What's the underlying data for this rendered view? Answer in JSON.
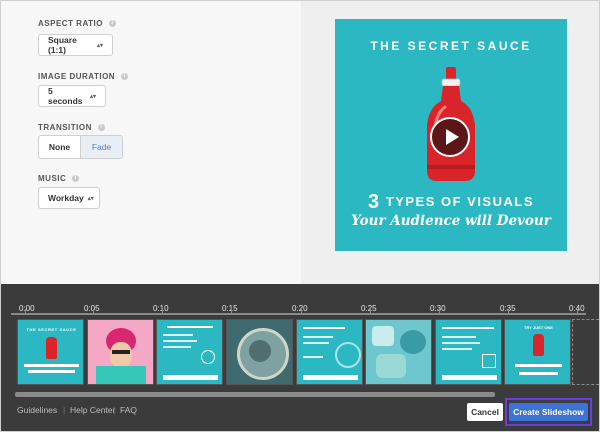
{
  "settings": {
    "aspect_ratio": {
      "label": "ASPECT RATIO",
      "value": "Square (1:1)"
    },
    "image_duration": {
      "label": "IMAGE DURATION",
      "value": "5 seconds"
    },
    "transition": {
      "label": "TRANSITION",
      "options": [
        "None",
        "Fade"
      ],
      "selected": "Fade"
    },
    "music": {
      "label": "MUSIC",
      "value": "Workday"
    }
  },
  "preview": {
    "title": "THE SECRET SAUCE",
    "number": "3",
    "line1_rest": "TYPES OF VISUALS",
    "line2": "Your Audience will Devour",
    "play_icon": "play-icon"
  },
  "timeline": {
    "ticks": [
      "0:00",
      "0:05",
      "0:10",
      "0:15",
      "0:20",
      "0:25",
      "0:30",
      "0:35",
      "0:40"
    ]
  },
  "footer": {
    "links": [
      "Guidelines",
      "Help Center",
      "FAQ"
    ],
    "cancel_label": "Cancel",
    "create_label": "Create Slideshow"
  },
  "colors": {
    "teal": "#2bb8c3",
    "bottle_red": "#d9252a",
    "primary_button": "#3f72d6",
    "highlight_ring": "#6b3ce0"
  }
}
